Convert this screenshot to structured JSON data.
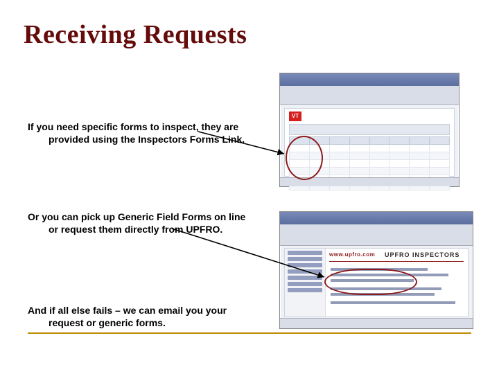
{
  "title": "Receiving Requests",
  "para1": "If you need specific forms to inspect, they are provided using the Inspectors Forms Link.",
  "para2": "Or you can pick up Generic Field Forms on line or request them directly from UPFRO.",
  "para3": "And if all else fails – we can email you your request or generic forms.",
  "shot1": {
    "logo": "VT"
  },
  "shot2": {
    "brand": "www.upfro.com",
    "heading": "UPFRO INSPECTORS"
  }
}
